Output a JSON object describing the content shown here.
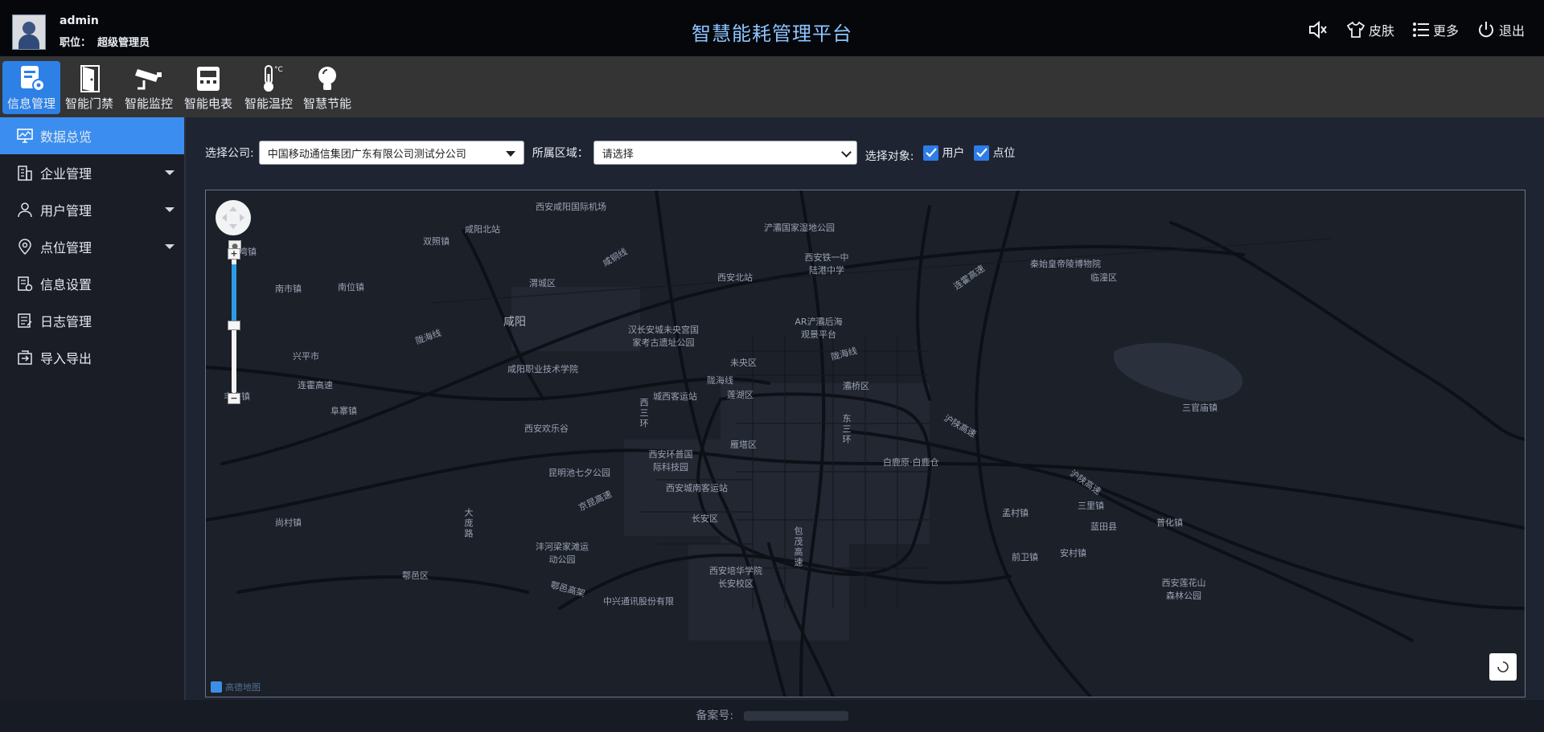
{
  "header": {
    "user_name": "admin",
    "role_label": "职位：",
    "role_value": "超级管理员",
    "title": "智慧能耗管理平台",
    "actions": {
      "mute_icon": "speaker-mute-icon",
      "skin": "皮肤",
      "more": "更多",
      "logout": "退出"
    }
  },
  "toolbar": {
    "items": [
      {
        "label": "信息管理",
        "icon": "info-manage-icon"
      },
      {
        "label": "智能门禁",
        "icon": "door-icon"
      },
      {
        "label": "智能监控",
        "icon": "camera-icon"
      },
      {
        "label": "智能电表",
        "icon": "meter-icon"
      },
      {
        "label": "智能温控",
        "icon": "thermometer-icon"
      },
      {
        "label": "智慧节能",
        "icon": "bulb-icon"
      }
    ]
  },
  "sidebar": {
    "items": [
      {
        "label": "数据总览",
        "icon": "monitor-icon"
      },
      {
        "label": "企业管理",
        "icon": "building-icon"
      },
      {
        "label": "用户管理",
        "icon": "user-icon"
      },
      {
        "label": "点位管理",
        "icon": "location-pin-icon"
      },
      {
        "label": "信息设置",
        "icon": "settings-doc-icon"
      },
      {
        "label": "日志管理",
        "icon": "log-icon"
      },
      {
        "label": "导入导出",
        "icon": "import-export-icon"
      }
    ]
  },
  "filters": {
    "company_label": "选择公司:",
    "company_value": "中国移动通信集团广东有限公司测试分公司",
    "region_label": "所属区域：",
    "region_value": "请选择",
    "target_label": "选择对象:",
    "target_user": "用户",
    "target_point": "点位"
  },
  "map": {
    "logo_text": "高德地图",
    "labels": {
      "l1": "西安咸阳国际机场",
      "l2": "咸阳北站",
      "l3": "双照镇",
      "l4": "渭城区",
      "l5": "咸阳",
      "l6": "南市镇",
      "l7": "南位镇",
      "l8": "兴平市",
      "l9": "连霍高速",
      "l10": "丰仪镇",
      "l11": "阜寨镇",
      "l12": "咸阳职业技术学院",
      "l13": "西安欢乐谷",
      "l14": "昆明池七夕公园",
      "l15": "尚村镇",
      "l16": "鄠邑区",
      "l17": "沣河梁家滩运动公园",
      "l18": "汉长安城未央宫国家考古遗址公园",
      "l19": "城西客运站",
      "l20": "西安北站",
      "l21": "未央区",
      "l22": "莲湖区",
      "l23": "陇海线",
      "l24": "雁塔区",
      "l25": "西安环普国际科技园",
      "l26": "西安城南客运站",
      "l27": "长安区",
      "l28": "西安培华学院长安校区",
      "l29": "中兴通讯股份有限",
      "l30": "浐灞国家湿地公园",
      "l31": "西安铁一中陆港中学",
      "l32": "AR浐灞后海观景平台",
      "l33": "灞桥区",
      "l34": "临潼区",
      "l35": "秦始皇帝陵博物院",
      "l36": "连霍高速",
      "l37": "沪陕高速",
      "l38": "白鹿原·白鹿仓",
      "l39": "三官庙镇",
      "l40": "孟村镇",
      "l41": "前卫镇",
      "l42": "安村镇",
      "l43": "蓝田县",
      "l44": "三里镇",
      "l45": "普化镇",
      "l46": "西安莲花山森林公园",
      "l47": "京昆高速",
      "l48": "陇海线",
      "l49": "陇海线",
      "l50": "包茂高速",
      "l51": "西三环",
      "l52": "东三环",
      "l53": "大庞路",
      "l54": "鄠邑高架",
      "l55": "咸铜线",
      "l56": "沪陕高速",
      "l57": "史湾镇"
    }
  },
  "footer": {
    "record_label": "备案号:"
  }
}
